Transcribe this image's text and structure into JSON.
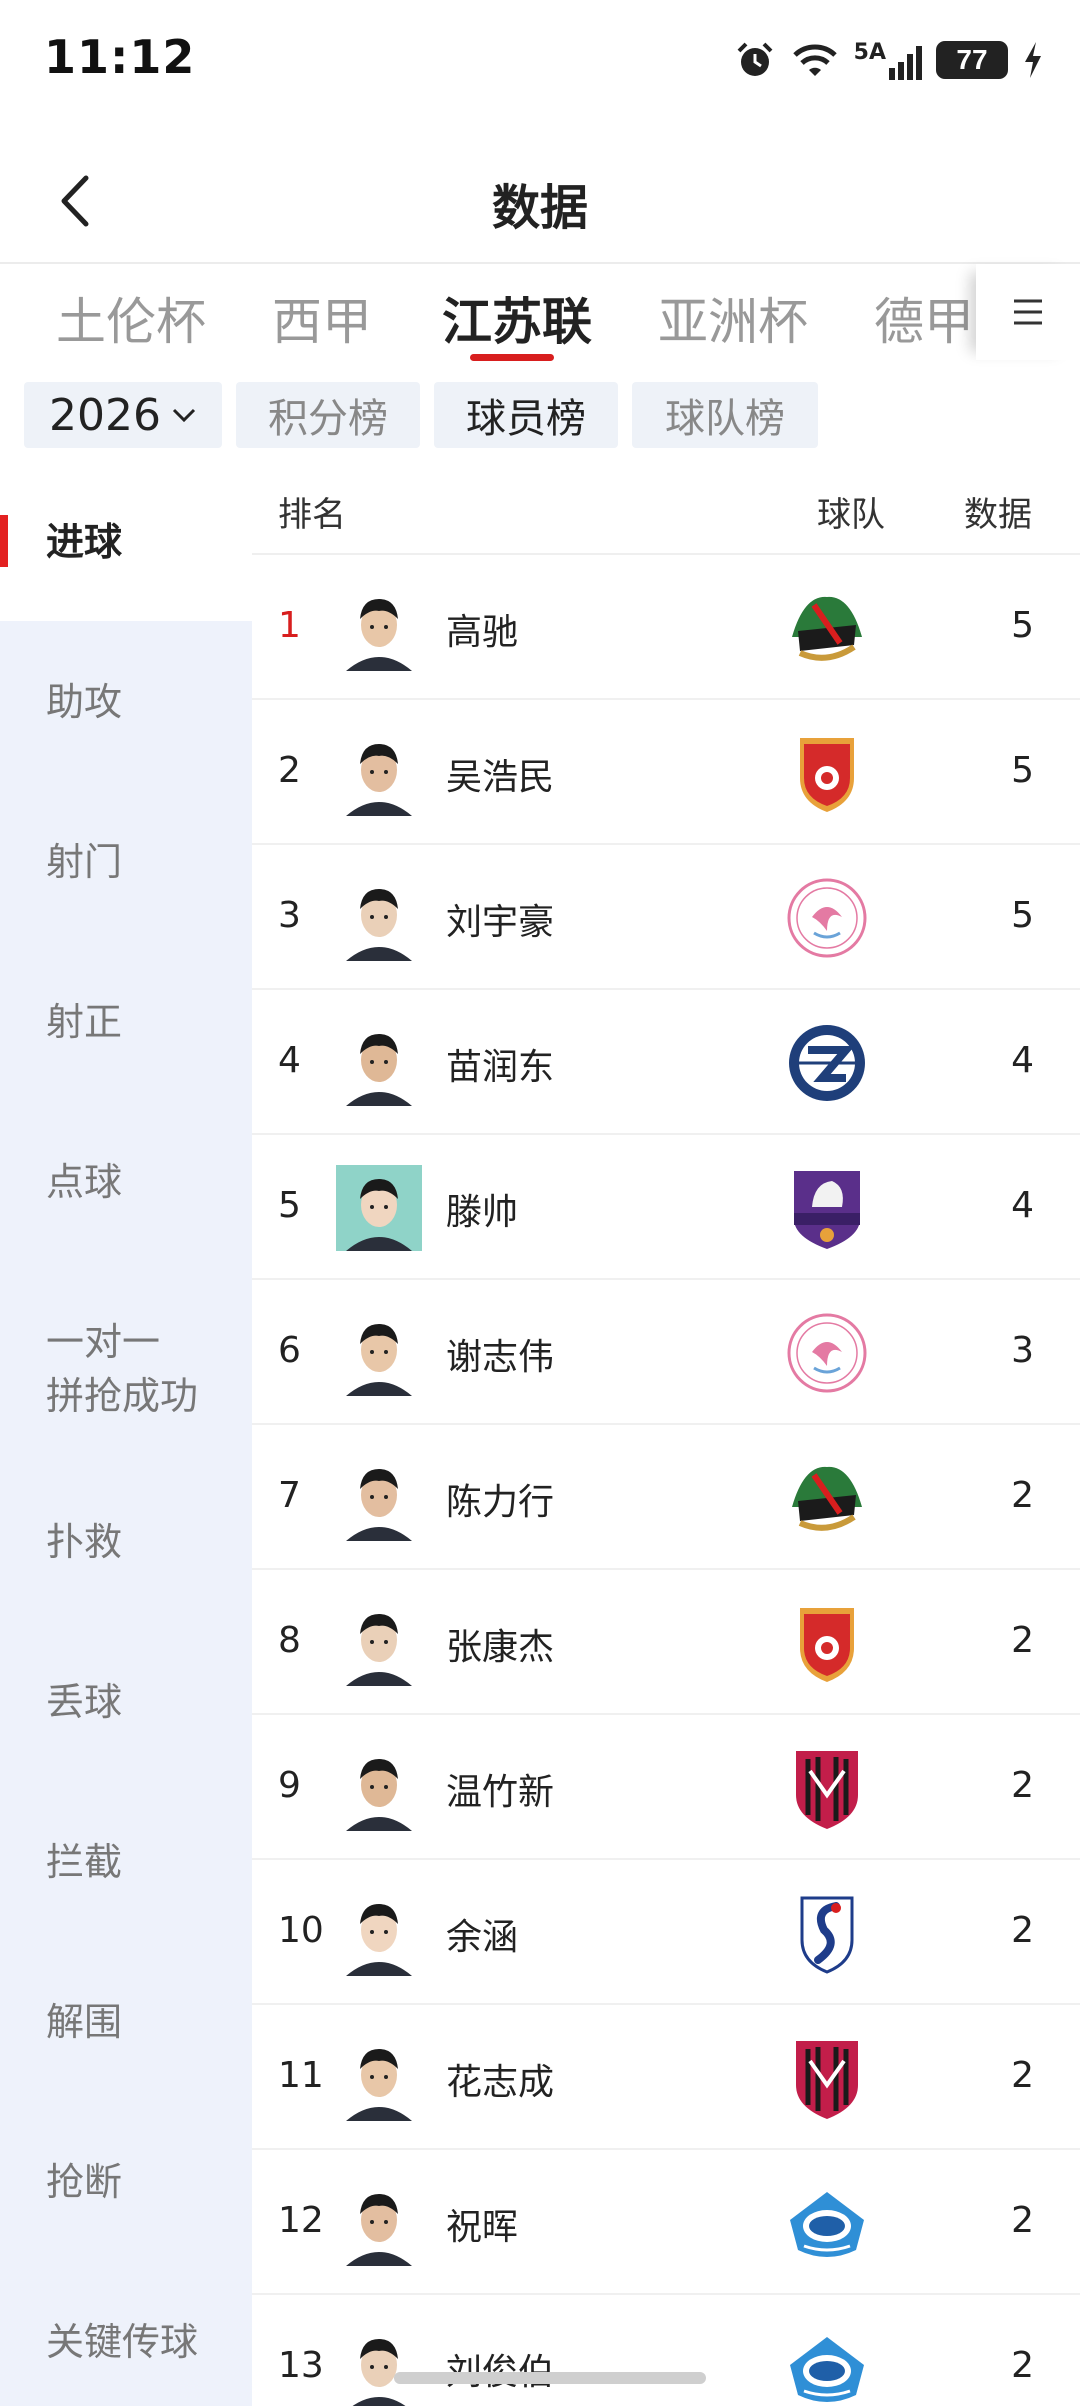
{
  "status_bar": {
    "time": "11:12",
    "network": "5A",
    "battery": "77"
  },
  "header": {
    "title": "数据"
  },
  "league_tabs": [
    "土伦杯",
    "西甲",
    "江苏联",
    "亚洲杯",
    "德甲"
  ],
  "active_league_index": 2,
  "filters": {
    "year": "2026",
    "tabs": [
      "积分榜",
      "球员榜",
      "球队榜"
    ],
    "active_tab_index": 1
  },
  "categories": [
    "进球",
    "助攻",
    "射门",
    "射正",
    "点球",
    "一对一\n拼抢成功",
    "扑救",
    "丢球",
    "拦截",
    "解围",
    "抢断",
    "关键传球"
  ],
  "active_category_index": 0,
  "table": {
    "headers": {
      "rank": "排名",
      "team": "球队",
      "data": "数据"
    },
    "rows": [
      {
        "rank": "1",
        "name": "高驰",
        "team_badge": "suqian-badge",
        "value": "5"
      },
      {
        "rank": "2",
        "name": "吴浩民",
        "team_badge": "changzhou-badge",
        "value": "5"
      },
      {
        "rank": "3",
        "name": "刘宇豪",
        "team_badge": "wuxi-badge",
        "value": "5"
      },
      {
        "rank": "4",
        "name": "苗润东",
        "team_badge": "lianyungang-badge",
        "value": "4"
      },
      {
        "rank": "5",
        "name": "滕帅",
        "team_badge": "nanjing-badge",
        "value": "4"
      },
      {
        "rank": "6",
        "name": "谢志伟",
        "team_badge": "wuxi-badge",
        "value": "3"
      },
      {
        "rank": "7",
        "name": "陈力行",
        "team_badge": "suqian-badge",
        "value": "2"
      },
      {
        "rank": "8",
        "name": "张康杰",
        "team_badge": "changzhou-badge",
        "value": "2"
      },
      {
        "rank": "9",
        "name": "温竹新",
        "team_badge": "yancheng-badge",
        "value": "2"
      },
      {
        "rank": "10",
        "name": "余涵",
        "team_badge": "dragon-badge",
        "value": "2"
      },
      {
        "rank": "11",
        "name": "花志成",
        "team_badge": "yancheng-badge",
        "value": "2"
      },
      {
        "rank": "12",
        "name": "祝晖",
        "team_badge": "taizhou-badge",
        "value": "2"
      },
      {
        "rank": "13",
        "name": "刘俊伯",
        "team_badge": "taizhou-badge",
        "value": "2"
      }
    ]
  },
  "colors": {
    "accent": "#d81e1e",
    "sidebar_bg": "#eef2fb",
    "chip_bg": "#eef2f8"
  }
}
